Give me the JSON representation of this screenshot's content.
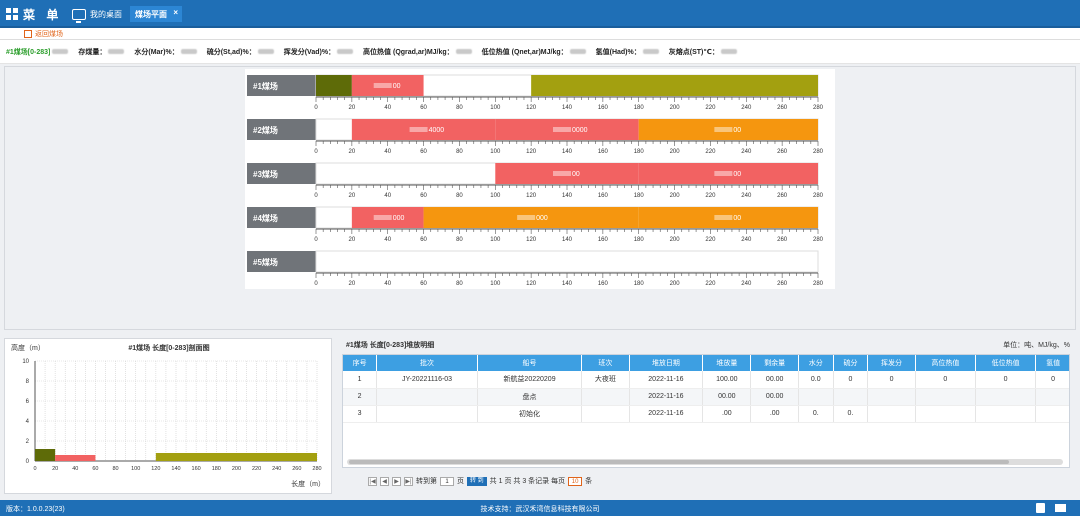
{
  "app": {
    "menu_label": "菜 单",
    "version": "版本：1.0.0.23(23)",
    "support": "技术支持：武汉禾湾信息科技有限公司"
  },
  "tabs": {
    "desktop": "我的桌面",
    "active": "煤场平面",
    "close": "×"
  },
  "toolbar": {
    "back_label": "返回煤场"
  },
  "info": [
    {
      "label": "#1煤场[0-283]"
    },
    {
      "label": "存煤量："
    },
    {
      "label": "水分(Mar)%："
    },
    {
      "label": "硫分(St,ad)%："
    },
    {
      "label": "挥发分(Vad)%："
    },
    {
      "label": "高位热值 (Qgrad,ar)MJ/kg："
    },
    {
      "label": "低位热值 (Qnet,ar)MJ/kg："
    },
    {
      "label": "氢值(Had)%："
    },
    {
      "label": "灰熔点(ST)℃："
    }
  ],
  "yards": {
    "axis_max": 280,
    "ticks": [
      "0",
      "20",
      "40",
      "60",
      "80",
      "100",
      "120",
      "140",
      "160",
      "180",
      "200",
      "220",
      "240",
      "260",
      "280"
    ],
    "items": [
      {
        "name": "#1煤场",
        "segments": [
          {
            "start": 0,
            "end": 20,
            "color": "#5e6b08",
            "label": ""
          },
          {
            "start": 20,
            "end": 60,
            "color": "#f26262",
            "label": "00"
          },
          {
            "start": 120,
            "end": 283,
            "color": "#a3a010",
            "label": ""
          }
        ]
      },
      {
        "name": "#2煤场",
        "segments": [
          {
            "start": 20,
            "end": 100,
            "color": "#f26262",
            "label": "4000"
          },
          {
            "start": 100,
            "end": 180,
            "color": "#f26262",
            "label": "0000"
          },
          {
            "start": 180,
            "end": 283,
            "color": "#f5960f",
            "label": "00"
          }
        ]
      },
      {
        "name": "#3煤场",
        "segments": [
          {
            "start": 100,
            "end": 180,
            "color": "#f26262",
            "label": "00"
          },
          {
            "start": 180,
            "end": 283,
            "color": "#f26262",
            "label": "00"
          }
        ]
      },
      {
        "name": "#4煤场",
        "segments": [
          {
            "start": 20,
            "end": 60,
            "color": "#f26262",
            "label": "000"
          },
          {
            "start": 60,
            "end": 180,
            "color": "#f5960f",
            "label": "000"
          },
          {
            "start": 180,
            "end": 283,
            "color": "#f5960f",
            "label": "00"
          }
        ]
      },
      {
        "name": "#5煤场",
        "segments": []
      }
    ]
  },
  "profile": {
    "title": "#1煤场 长度[0-283]剖面图",
    "ylabel": "高度（m）",
    "xlabel": "长度（m）",
    "yticks": [
      "0",
      "2",
      "4",
      "6",
      "8",
      "10"
    ],
    "xticks": [
      "0",
      "20",
      "40",
      "60",
      "80",
      "100",
      "120",
      "140",
      "160",
      "180",
      "200",
      "220",
      "240",
      "260",
      "280"
    ],
    "bars": [
      {
        "start": 0,
        "end": 20,
        "height": 1.2,
        "color": "#5e6b08"
      },
      {
        "start": 20,
        "end": 60,
        "height": 0.6,
        "color": "#f26262"
      },
      {
        "start": 120,
        "end": 283,
        "height": 0.8,
        "color": "#a3a010"
      }
    ]
  },
  "detail": {
    "title": "#1煤场 长度[0-283]堆放明细",
    "unit": "单位：吨、MJ/kg、%",
    "columns": [
      "序号",
      "批次",
      "船号",
      "班次",
      "堆放日期",
      "堆放量",
      "剩余量",
      "水分",
      "硫分",
      "挥发分",
      "高位热值",
      "低位热值",
      "氢值"
    ],
    "rows": [
      [
        "1",
        "JY-20221116-03",
        "新航益20220209",
        "大夜班",
        "2022-11-16",
        "100.00",
        "00.00",
        "0.0",
        "0",
        "0",
        "0",
        "0",
        "0"
      ],
      [
        "2",
        "",
        "盘点",
        "",
        "2022-11-16",
        "00.00",
        "00.00",
        "",
        "",
        "",
        "",
        "",
        ""
      ],
      [
        "3",
        "",
        "初始化",
        "",
        "2022-11-16",
        ".00",
        ".00",
        "0.",
        "0.",
        "",
        "",
        "",
        ""
      ]
    ]
  },
  "pager": {
    "goto": "转到第",
    "page": "1",
    "page_unit": "页",
    "go": "转 到",
    "summary": "共 1 页 共 3 条记录 每页",
    "page_size": "10",
    "size_unit": "条"
  }
}
